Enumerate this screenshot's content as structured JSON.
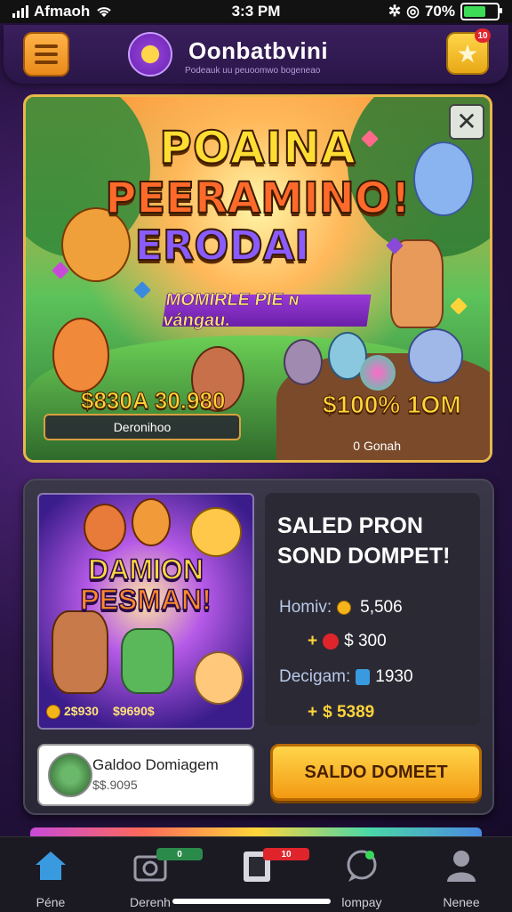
{
  "status_bar": {
    "carrier": "Afmaoh",
    "time": "3:3 PM",
    "battery": "70%",
    "battery_level": 0.7
  },
  "header": {
    "title": "Oonbatbvini",
    "subtitle": "Podeauk uu peuoomwo bogeneao",
    "menu_icon": "hamburger-menu-icon",
    "logo_icon": "app-logo-icon",
    "star_icon": "star-icon",
    "notification_count": "10"
  },
  "hero": {
    "title_line1": "POAINA",
    "title_line2": "PEERAMINO!",
    "title_line3": "ERODAI",
    "ribbon": "MOMIRLE PIE ɴ vángau.",
    "price_left": "$830A 30.980",
    "price_right": "$100% 1OM",
    "pill_label": "Deronihoo",
    "footer_text": "0 Gonah",
    "close_icon": "close-icon"
  },
  "promo": {
    "art_title_line1": "DAMION",
    "art_title_line2": "PESMAN!",
    "art_price_left": "2$930",
    "art_price_right": "$9690$",
    "title": "SALED PRON SOND DOMPET!",
    "rows": [
      {
        "label": "Homiv:",
        "value": "5,506",
        "icon": "coin-icon"
      },
      {
        "label": "",
        "value": "$ 300",
        "prefix": "+",
        "icon": "heart-icon"
      },
      {
        "label": "Decigam:",
        "value": "1930",
        "icon": "gem-icon"
      },
      {
        "label": "",
        "value": "$ 5389",
        "prefix": "+",
        "icon": "coin-icon"
      }
    ],
    "player_name": "Galdoo Domiagem",
    "player_coins": "$$.9095",
    "cta_label": "SALDO DOMEET"
  },
  "nav": {
    "items": [
      {
        "label": "Péne",
        "icon": "home-icon",
        "badge": ""
      },
      {
        "label": "Derenh",
        "icon": "camera-icon",
        "badge": "0"
      },
      {
        "label": "",
        "icon": "document-icon",
        "badge": "10"
      },
      {
        "label": "lompay",
        "icon": "chat-icon",
        "badge": ""
      },
      {
        "label": "Nenee",
        "icon": "profile-icon",
        "badge": ""
      }
    ]
  },
  "colors": {
    "accent_orange": "#f39a12",
    "accent_gold": "#ffd43a",
    "nav_active": "#3a9ae0",
    "background": "#2a1446"
  }
}
